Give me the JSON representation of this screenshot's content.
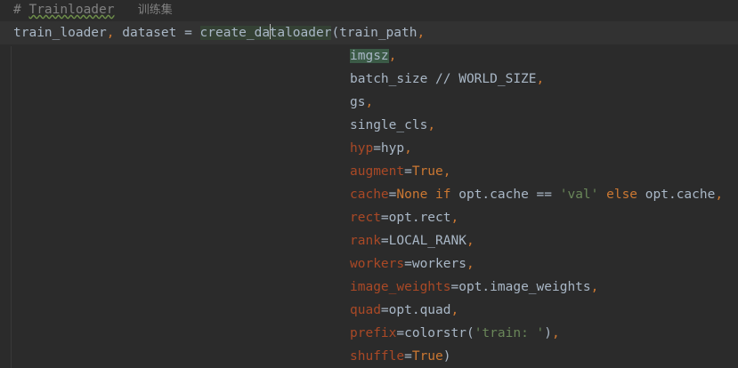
{
  "comment": {
    "hash": "# ",
    "word": "Trainloader",
    "gap": "   ",
    "cjk": "训练集"
  },
  "call": {
    "lhs1": "train_loader",
    "comma1": ",",
    "lhs2": " dataset = ",
    "fn_a": "create_da",
    "fn_b": "taloader",
    "open": "(train_path",
    "comma": ","
  },
  "args": {
    "imgsz": "imgsz",
    "batch_size": "batch_size // WORLD_SIZE",
    "gs": "gs",
    "single_cls": "single_cls",
    "hyp_kw": "hyp",
    "hyp_val": "=hyp",
    "augment_kw": "augment",
    "augment_eq": "=",
    "augment_val": "True",
    "cache_kw": "cache",
    "cache_eq": "=",
    "cache_none": "None",
    "cache_if": " if ",
    "cache_opt": "opt.cache == ",
    "cache_str": "'val'",
    "cache_else": " else ",
    "cache_tail": "opt.cache",
    "rect_kw": "rect",
    "rect_val": "=opt.rect",
    "rank_kw": "rank",
    "rank_val": "=LOCAL_RANK",
    "workers_kw": "workers",
    "workers_val": "=workers",
    "image_weights_kw": "image_weights",
    "image_weights_val": "=opt.image_weights",
    "quad_kw": "quad",
    "quad_val": "=opt.quad",
    "prefix_kw": "prefix",
    "prefix_val": "=colorstr(",
    "prefix_str": "'train: '",
    "prefix_close": ")",
    "shuffle_kw": "shuffle",
    "shuffle_eq": "=",
    "shuffle_val": "True",
    "shuffle_close": ")"
  },
  "comma": ","
}
